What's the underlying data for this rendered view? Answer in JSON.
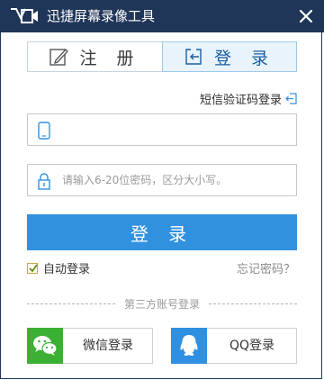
{
  "window": {
    "title": "迅捷屏幕录像工具",
    "close_icon": "close-icon",
    "logo_icon": "video-camera-icon"
  },
  "tabs": [
    {
      "label": "注 册",
      "icon": "edit-icon",
      "active": false
    },
    {
      "label": "登 录",
      "icon": "login-arrow-icon",
      "active": true
    }
  ],
  "sms_login_link": "短信验证码登录",
  "phone_input": {
    "value": "",
    "placeholder": "",
    "icon": "phone-icon"
  },
  "password_input": {
    "value": "",
    "placeholder": "请输入6-20位密码，区分大小写。",
    "icon": "lock-icon"
  },
  "login_button": "登 录",
  "auto_login": {
    "label": "自动登录",
    "checked": true
  },
  "forgot_password": "忘记密码？",
  "third_party_label": "第三方账号登录",
  "social": [
    {
      "label": "微信登录",
      "icon": "wechat-icon"
    },
    {
      "label": "QQ登录",
      "icon": "qq-icon"
    }
  ],
  "colors": {
    "titlebar": "#1f3658",
    "primary": "#3291df",
    "wechat": "#3cb034",
    "qq": "#2f8fe0"
  }
}
